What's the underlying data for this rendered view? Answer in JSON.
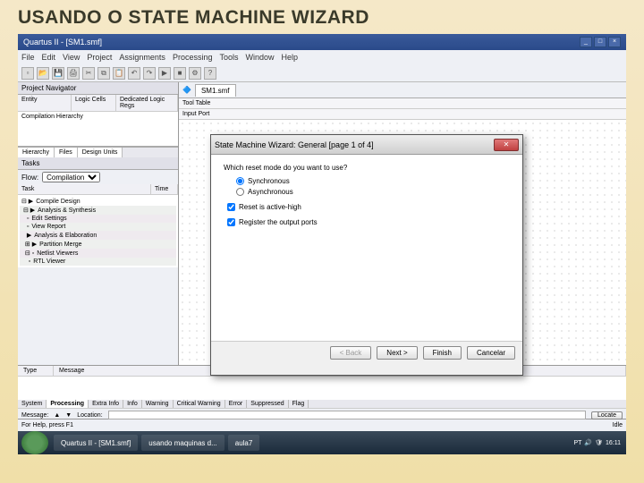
{
  "slide": {
    "title": "USANDO O STATE MACHINE WIZARD"
  },
  "ide": {
    "titlebar": "Quartus II - [SM1.smf]",
    "menus": [
      "File",
      "Edit",
      "View",
      "Project",
      "Assignments",
      "Processing",
      "Tools",
      "Window",
      "Help"
    ],
    "nav": {
      "header": "Project Navigator",
      "cols": [
        "Entity",
        "Logic Cells",
        "Dedicated Logic Regs"
      ],
      "row1": "Compilation Hierarchy",
      "tabs": [
        "Hierarchy",
        "Files",
        "Design Units"
      ]
    },
    "tasks": {
      "header": "Tasks",
      "flow_label": "Flow:",
      "flow_value": "Compilation",
      "col1": "Task",
      "col2": "Time",
      "items": [
        "Compile Design",
        "Analysis & Synthesis",
        "Edit Settings",
        "View Report",
        "Analysis & Elaboration",
        "Partition Merge",
        "Netlist Viewers",
        "RTL Viewer"
      ]
    },
    "doc": {
      "tab": "SM1.smf",
      "tool_header": "Tool Table",
      "tool_sub": "Input Port"
    },
    "messages": {
      "cols": [
        "Type",
        "Message"
      ],
      "tabs": [
        "System",
        "Processing",
        "Extra Info",
        "Info",
        "Warning",
        "Critical Warning",
        "Error",
        "Suppressed",
        "Flag"
      ],
      "footer_label": "Message:",
      "location_label": "Location:",
      "locate_btn": "Locate"
    },
    "status": {
      "left": "For Help, press F1",
      "right": "Idle"
    }
  },
  "wizard": {
    "title": "State Machine Wizard: General [page 1 of 4]",
    "question": "Which reset mode do you want to use?",
    "opt_sync": "Synchronous",
    "opt_async": "Asynchronous",
    "chk_active_high": "Reset is active-high",
    "chk_register_out": "Register the output ports",
    "btn_back": "< Back",
    "btn_next": "Next >",
    "btn_finish": "Finish",
    "btn_cancel": "Cancelar"
  },
  "taskbar": {
    "items": [
      "Quartus II - [SM1.smf]",
      "usando maquinas d...",
      "aula7"
    ],
    "lang": "PT",
    "time": "16:11"
  }
}
